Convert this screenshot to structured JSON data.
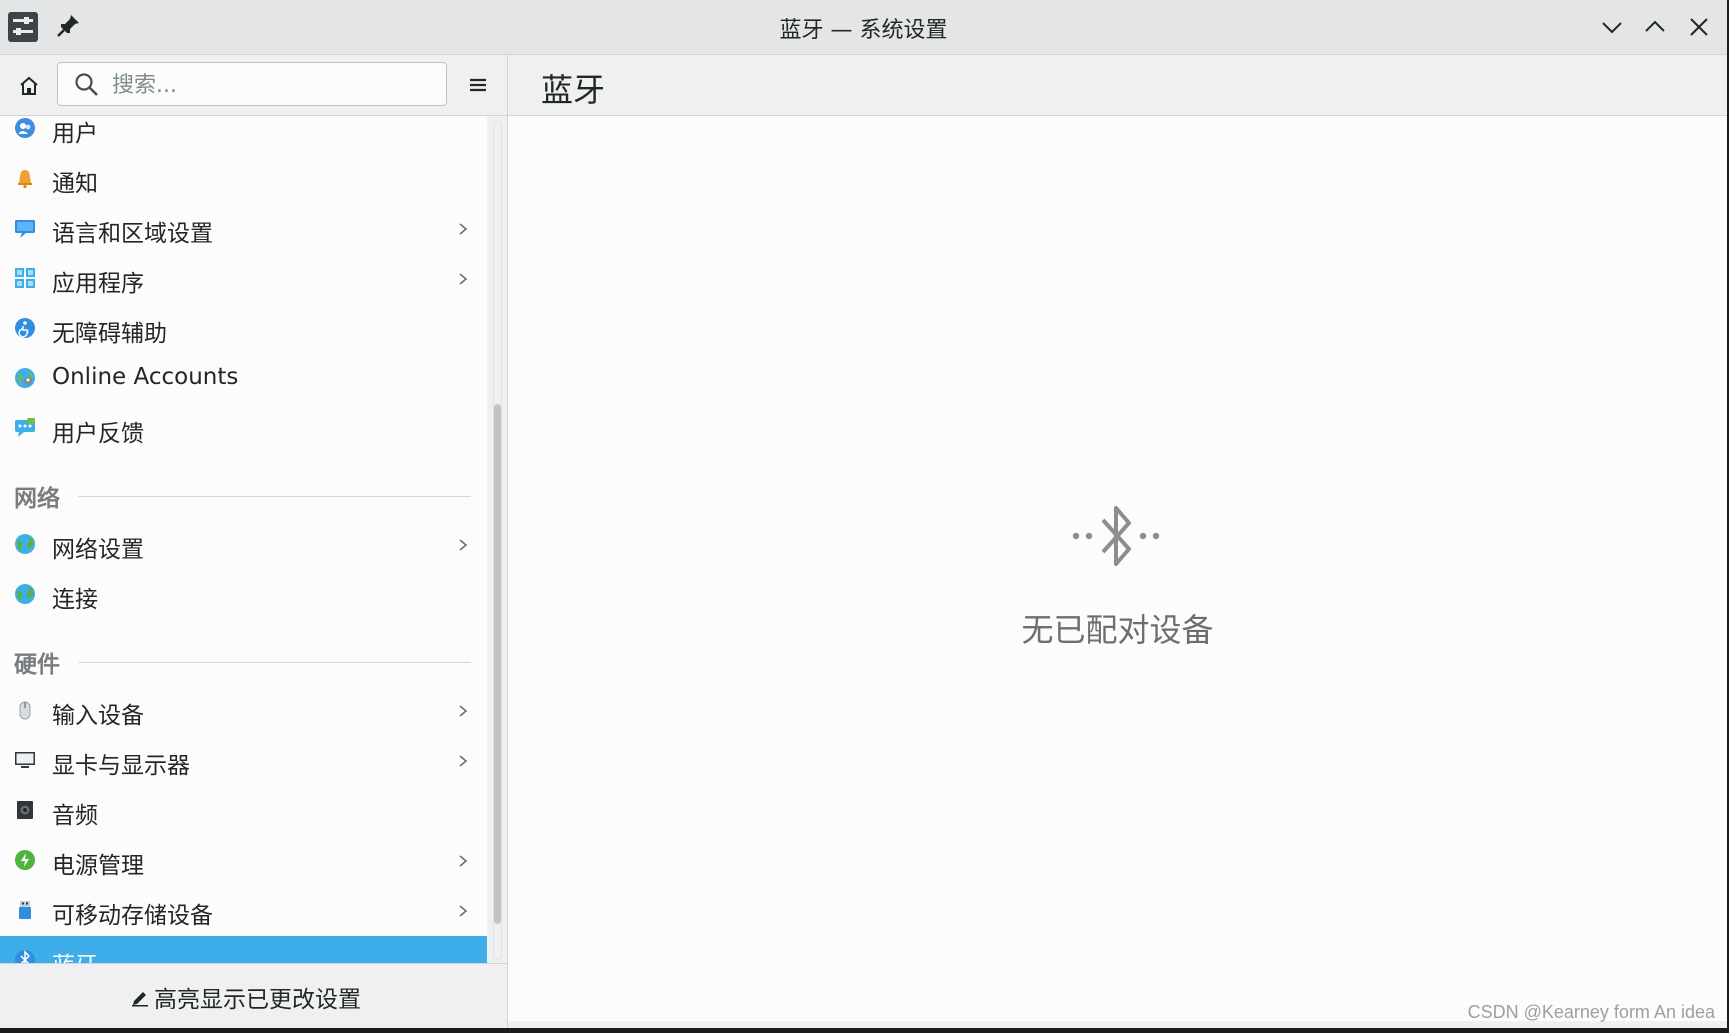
{
  "window": {
    "title": "蓝牙 — 系统设置"
  },
  "toolbar": {
    "search_placeholder": "搜索...",
    "page_title": "蓝牙"
  },
  "sidebar": {
    "items": [
      {
        "label": "用户",
        "icon": "users-icon",
        "has_children": false
      },
      {
        "label": "通知",
        "icon": "bell-icon",
        "has_children": false
      },
      {
        "label": "语言和区域设置",
        "icon": "locale-icon",
        "has_children": true
      },
      {
        "label": "应用程序",
        "icon": "apps-icon",
        "has_children": true
      },
      {
        "label": "无障碍辅助",
        "icon": "accessibility-icon",
        "has_children": false
      },
      {
        "label": "Online Accounts",
        "icon": "online-accounts-icon",
        "has_children": false
      },
      {
        "label": "用户反馈",
        "icon": "feedback-icon",
        "has_children": false
      }
    ],
    "section_network": "网络",
    "network_items": [
      {
        "label": "网络设置",
        "icon": "globe-icon",
        "has_children": true
      },
      {
        "label": "连接",
        "icon": "globe-icon",
        "has_children": false
      }
    ],
    "section_hardware": "硬件",
    "hardware_items": [
      {
        "label": "输入设备",
        "icon": "mouse-icon",
        "has_children": true
      },
      {
        "label": "显卡与显示器",
        "icon": "monitor-icon",
        "has_children": true
      },
      {
        "label": "音频",
        "icon": "speaker-icon",
        "has_children": false
      },
      {
        "label": "电源管理",
        "icon": "power-icon",
        "has_children": true
      },
      {
        "label": "可移动存储设备",
        "icon": "usb-icon",
        "has_children": true
      },
      {
        "label": "蓝牙",
        "icon": "bluetooth-icon",
        "has_children": false,
        "selected": true
      }
    ],
    "footer_button": "高亮显示已更改设置"
  },
  "content": {
    "empty_message": "无已配对设备"
  },
  "watermark": "CSDN @Kearney form An idea",
  "colors": {
    "accent": "#3daee9",
    "background": "#eff0f1",
    "view": "#fcfcfc"
  }
}
